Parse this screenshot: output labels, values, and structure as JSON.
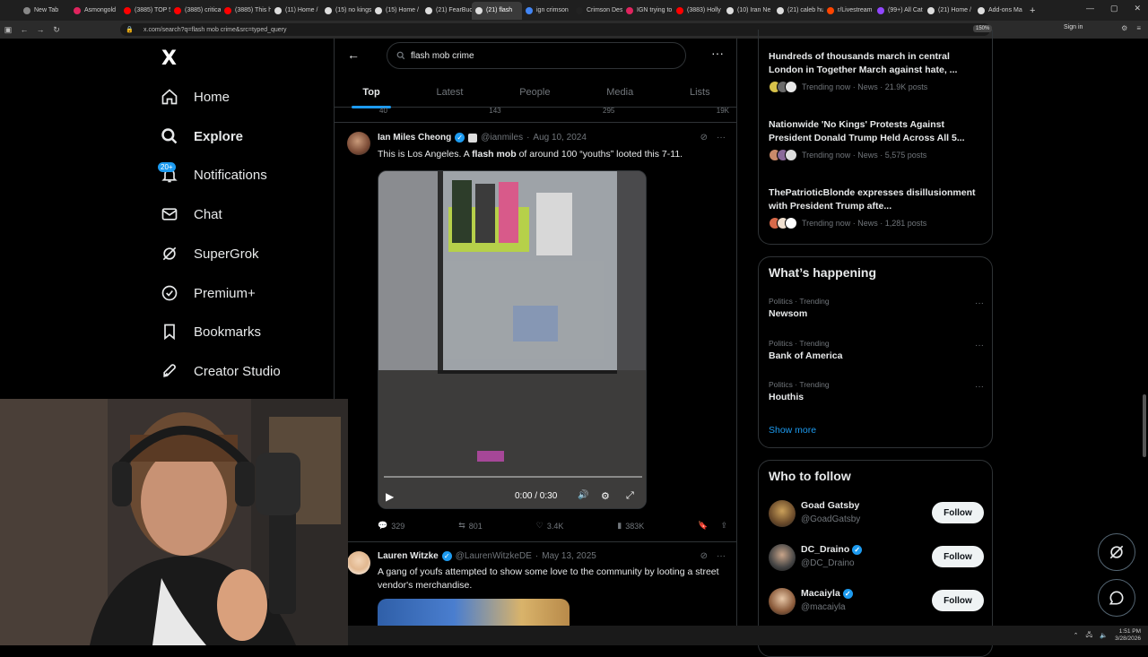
{
  "browser": {
    "tabs": [
      {
        "label": "New Tab",
        "color": "#888888"
      },
      {
        "label": "Asmongold",
        "color": "#e0245e"
      },
      {
        "label": "(3885) TOP 5",
        "color": "#ff0000"
      },
      {
        "label": "(3885) critica",
        "color": "#ff0000"
      },
      {
        "label": "(3885) This h",
        "color": "#ff0000"
      },
      {
        "label": "(11) Home /",
        "color": "#dddddd"
      },
      {
        "label": "(15) no kings",
        "color": "#dddddd"
      },
      {
        "label": "(15) Home /",
        "color": "#dddddd"
      },
      {
        "label": "(21) FearBuck",
        "color": "#dddddd"
      },
      {
        "label": "(21) flash",
        "color": "#dddddd",
        "active": true
      },
      {
        "label": "ign crimson",
        "color": "#4285f4"
      },
      {
        "label": "Crimson Des",
        "color": "#222222"
      },
      {
        "label": "IGN trying to",
        "color": "#e0245e"
      },
      {
        "label": "(3883) Holly",
        "color": "#ff0000"
      },
      {
        "label": "(10) Iran Ne",
        "color": "#dddddd"
      },
      {
        "label": "(21) caleb hu",
        "color": "#dddddd"
      },
      {
        "label": "r/Livestream",
        "color": "#ff4500"
      },
      {
        "label": "(99+) All Cat",
        "color": "#9146ff"
      },
      {
        "label": "(21) Home /",
        "color": "#dddddd"
      },
      {
        "label": "Add-ons Ma",
        "color": "#dddddd"
      }
    ],
    "url": "x.com/search?q=flash mob crime&src=typed_query",
    "zoom": "150%",
    "signin": "Sign in"
  },
  "sidebar": {
    "logo": "X",
    "items": [
      {
        "label": "Home",
        "icon": "home-icon"
      },
      {
        "label": "Explore",
        "icon": "search-icon",
        "bold": true
      },
      {
        "label": "Notifications",
        "icon": "bell-icon",
        "badge": "20+"
      },
      {
        "label": "Chat",
        "icon": "mail-icon"
      },
      {
        "label": "SuperGrok",
        "icon": "grok-icon"
      },
      {
        "label": "Premium+",
        "icon": "verified-badge-icon"
      },
      {
        "label": "Bookmarks",
        "icon": "bookmark-icon"
      },
      {
        "label": "Creator Studio",
        "icon": "rocket-icon"
      }
    ]
  },
  "search": {
    "query": "flash mob crime"
  },
  "tabs": [
    "Top",
    "Latest",
    "People",
    "Media",
    "Lists"
  ],
  "prev_actions": {
    "replies": "40",
    "reposts": "143",
    "likes": "295",
    "views": "19K"
  },
  "tweets": [
    {
      "name": "Ian Miles Cheong",
      "handle": "@ianmiles",
      "date": "Aug 10, 2024",
      "text_pre": "This is Los Angeles. A ",
      "text_bold": "flash mob",
      "text_post": " of around 100 “youths” looted this 7-11.",
      "video_time": "0:00 / 0:30",
      "replies": "329",
      "reposts": "801",
      "likes": "3.4K",
      "views": "383K"
    },
    {
      "name": "Lauren Witzke",
      "handle": "@LaurenWitzkeDE",
      "date": "May 13, 2025",
      "text": "A gang of youfs attempted to show some love to the community by looting a street vendor's merchandise."
    }
  ],
  "right": {
    "news": [
      {
        "title": "Hundreds of thousands march in central London in Together March against hate, ...",
        "meta": "Trending now · News · 21.9K posts"
      },
      {
        "title": "Nationwide 'No Kings' Protests Against President Donald Trump Held Across All 5...",
        "meta": "Trending now · News · 5,575 posts"
      },
      {
        "title": "ThePatrioticBlonde expresses disillusionment with President Trump afte...",
        "meta": "Trending now · News · 1,281 posts"
      }
    ],
    "happening_title": "What’s happening",
    "trends": [
      {
        "category": "Politics · Trending",
        "name": "Newsom"
      },
      {
        "category": "Politics · Trending",
        "name": "Bank of America"
      },
      {
        "category": "Politics · Trending",
        "name": "Houthis"
      }
    ],
    "show_more": "Show more",
    "wtf_title": "Who to follow",
    "follow": [
      {
        "name": "Goad Gatsby",
        "handle": "@GoadGatsby",
        "verified": false,
        "follow": "Follow"
      },
      {
        "name": "DC_Draino",
        "handle": "@DC_Draino",
        "verified": true,
        "follow": "Follow"
      },
      {
        "name": "Macaiyla",
        "handle": "@macaiyla",
        "verified": true,
        "follow": "Follow"
      }
    ]
  },
  "taskbar": {
    "time": "1:51 PM",
    "date": "3/28/2026"
  },
  "colors": {
    "accent": "#1d9bf0",
    "bg": "#000000",
    "muted": "#71767b",
    "border": "#2f3336"
  }
}
